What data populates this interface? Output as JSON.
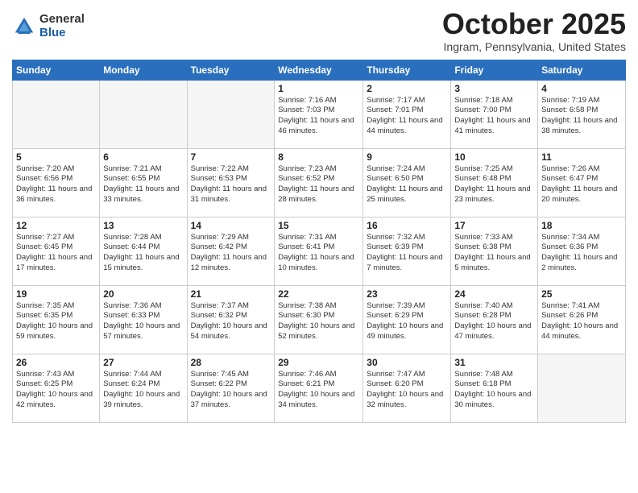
{
  "header": {
    "logo_general": "General",
    "logo_blue": "Blue",
    "month_title": "October 2025",
    "location": "Ingram, Pennsylvania, United States"
  },
  "weekdays": [
    "Sunday",
    "Monday",
    "Tuesday",
    "Wednesday",
    "Thursday",
    "Friday",
    "Saturday"
  ],
  "weeks": [
    [
      {
        "day": "",
        "sunrise": "",
        "sunset": "",
        "daylight": "",
        "empty": true
      },
      {
        "day": "",
        "sunrise": "",
        "sunset": "",
        "daylight": "",
        "empty": true
      },
      {
        "day": "",
        "sunrise": "",
        "sunset": "",
        "daylight": "",
        "empty": true
      },
      {
        "day": "1",
        "sunrise": "Sunrise: 7:16 AM",
        "sunset": "Sunset: 7:03 PM",
        "daylight": "Daylight: 11 hours and 46 minutes.",
        "empty": false
      },
      {
        "day": "2",
        "sunrise": "Sunrise: 7:17 AM",
        "sunset": "Sunset: 7:01 PM",
        "daylight": "Daylight: 11 hours and 44 minutes.",
        "empty": false
      },
      {
        "day": "3",
        "sunrise": "Sunrise: 7:18 AM",
        "sunset": "Sunset: 7:00 PM",
        "daylight": "Daylight: 11 hours and 41 minutes.",
        "empty": false
      },
      {
        "day": "4",
        "sunrise": "Sunrise: 7:19 AM",
        "sunset": "Sunset: 6:58 PM",
        "daylight": "Daylight: 11 hours and 38 minutes.",
        "empty": false
      }
    ],
    [
      {
        "day": "5",
        "sunrise": "Sunrise: 7:20 AM",
        "sunset": "Sunset: 6:56 PM",
        "daylight": "Daylight: 11 hours and 36 minutes.",
        "empty": false
      },
      {
        "day": "6",
        "sunrise": "Sunrise: 7:21 AM",
        "sunset": "Sunset: 6:55 PM",
        "daylight": "Daylight: 11 hours and 33 minutes.",
        "empty": false
      },
      {
        "day": "7",
        "sunrise": "Sunrise: 7:22 AM",
        "sunset": "Sunset: 6:53 PM",
        "daylight": "Daylight: 11 hours and 31 minutes.",
        "empty": false
      },
      {
        "day": "8",
        "sunrise": "Sunrise: 7:23 AM",
        "sunset": "Sunset: 6:52 PM",
        "daylight": "Daylight: 11 hours and 28 minutes.",
        "empty": false
      },
      {
        "day": "9",
        "sunrise": "Sunrise: 7:24 AM",
        "sunset": "Sunset: 6:50 PM",
        "daylight": "Daylight: 11 hours and 25 minutes.",
        "empty": false
      },
      {
        "day": "10",
        "sunrise": "Sunrise: 7:25 AM",
        "sunset": "Sunset: 6:48 PM",
        "daylight": "Daylight: 11 hours and 23 minutes.",
        "empty": false
      },
      {
        "day": "11",
        "sunrise": "Sunrise: 7:26 AM",
        "sunset": "Sunset: 6:47 PM",
        "daylight": "Daylight: 11 hours and 20 minutes.",
        "empty": false
      }
    ],
    [
      {
        "day": "12",
        "sunrise": "Sunrise: 7:27 AM",
        "sunset": "Sunset: 6:45 PM",
        "daylight": "Daylight: 11 hours and 17 minutes.",
        "empty": false
      },
      {
        "day": "13",
        "sunrise": "Sunrise: 7:28 AM",
        "sunset": "Sunset: 6:44 PM",
        "daylight": "Daylight: 11 hours and 15 minutes.",
        "empty": false
      },
      {
        "day": "14",
        "sunrise": "Sunrise: 7:29 AM",
        "sunset": "Sunset: 6:42 PM",
        "daylight": "Daylight: 11 hours and 12 minutes.",
        "empty": false
      },
      {
        "day": "15",
        "sunrise": "Sunrise: 7:31 AM",
        "sunset": "Sunset: 6:41 PM",
        "daylight": "Daylight: 11 hours and 10 minutes.",
        "empty": false
      },
      {
        "day": "16",
        "sunrise": "Sunrise: 7:32 AM",
        "sunset": "Sunset: 6:39 PM",
        "daylight": "Daylight: 11 hours and 7 minutes.",
        "empty": false
      },
      {
        "day": "17",
        "sunrise": "Sunrise: 7:33 AM",
        "sunset": "Sunset: 6:38 PM",
        "daylight": "Daylight: 11 hours and 5 minutes.",
        "empty": false
      },
      {
        "day": "18",
        "sunrise": "Sunrise: 7:34 AM",
        "sunset": "Sunset: 6:36 PM",
        "daylight": "Daylight: 11 hours and 2 minutes.",
        "empty": false
      }
    ],
    [
      {
        "day": "19",
        "sunrise": "Sunrise: 7:35 AM",
        "sunset": "Sunset: 6:35 PM",
        "daylight": "Daylight: 10 hours and 59 minutes.",
        "empty": false
      },
      {
        "day": "20",
        "sunrise": "Sunrise: 7:36 AM",
        "sunset": "Sunset: 6:33 PM",
        "daylight": "Daylight: 10 hours and 57 minutes.",
        "empty": false
      },
      {
        "day": "21",
        "sunrise": "Sunrise: 7:37 AM",
        "sunset": "Sunset: 6:32 PM",
        "daylight": "Daylight: 10 hours and 54 minutes.",
        "empty": false
      },
      {
        "day": "22",
        "sunrise": "Sunrise: 7:38 AM",
        "sunset": "Sunset: 6:30 PM",
        "daylight": "Daylight: 10 hours and 52 minutes.",
        "empty": false
      },
      {
        "day": "23",
        "sunrise": "Sunrise: 7:39 AM",
        "sunset": "Sunset: 6:29 PM",
        "daylight": "Daylight: 10 hours and 49 minutes.",
        "empty": false
      },
      {
        "day": "24",
        "sunrise": "Sunrise: 7:40 AM",
        "sunset": "Sunset: 6:28 PM",
        "daylight": "Daylight: 10 hours and 47 minutes.",
        "empty": false
      },
      {
        "day": "25",
        "sunrise": "Sunrise: 7:41 AM",
        "sunset": "Sunset: 6:26 PM",
        "daylight": "Daylight: 10 hours and 44 minutes.",
        "empty": false
      }
    ],
    [
      {
        "day": "26",
        "sunrise": "Sunrise: 7:43 AM",
        "sunset": "Sunset: 6:25 PM",
        "daylight": "Daylight: 10 hours and 42 minutes.",
        "empty": false
      },
      {
        "day": "27",
        "sunrise": "Sunrise: 7:44 AM",
        "sunset": "Sunset: 6:24 PM",
        "daylight": "Daylight: 10 hours and 39 minutes.",
        "empty": false
      },
      {
        "day": "28",
        "sunrise": "Sunrise: 7:45 AM",
        "sunset": "Sunset: 6:22 PM",
        "daylight": "Daylight: 10 hours and 37 minutes.",
        "empty": false
      },
      {
        "day": "29",
        "sunrise": "Sunrise: 7:46 AM",
        "sunset": "Sunset: 6:21 PM",
        "daylight": "Daylight: 10 hours and 34 minutes.",
        "empty": false
      },
      {
        "day": "30",
        "sunrise": "Sunrise: 7:47 AM",
        "sunset": "Sunset: 6:20 PM",
        "daylight": "Daylight: 10 hours and 32 minutes.",
        "empty": false
      },
      {
        "day": "31",
        "sunrise": "Sunrise: 7:48 AM",
        "sunset": "Sunset: 6:18 PM",
        "daylight": "Daylight: 10 hours and 30 minutes.",
        "empty": false
      },
      {
        "day": "",
        "sunrise": "",
        "sunset": "",
        "daylight": "",
        "empty": true
      }
    ]
  ]
}
